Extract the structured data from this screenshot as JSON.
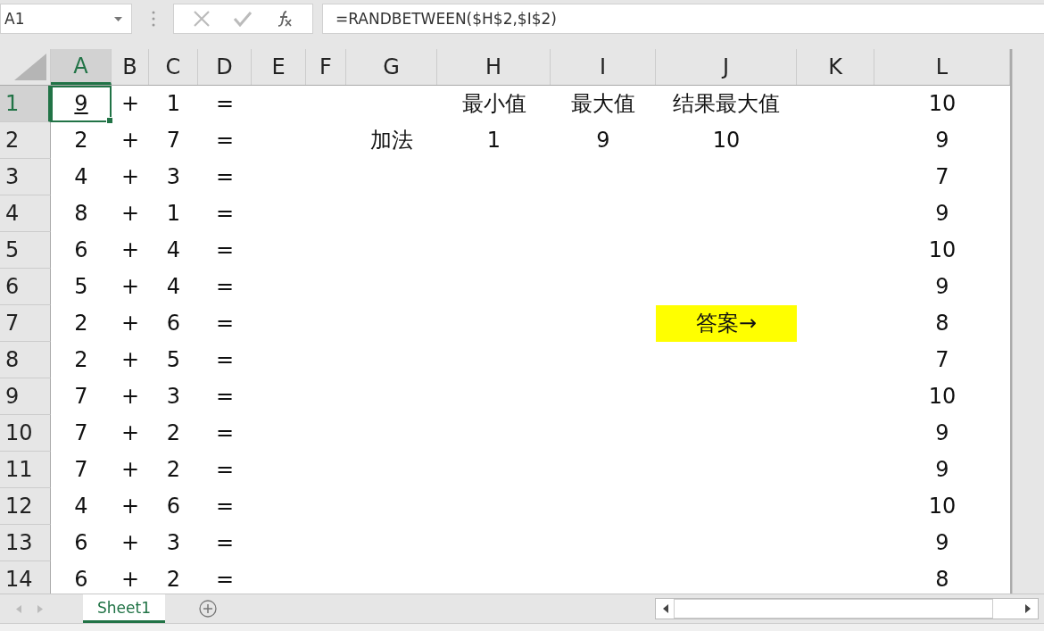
{
  "name_box": {
    "value": "A1"
  },
  "formula_bar": {
    "value": "=RANDBETWEEN($H$2,$I$2)"
  },
  "columns": [
    {
      "label": "A",
      "selected": true
    },
    {
      "label": "B",
      "selected": false
    },
    {
      "label": "C",
      "selected": false
    },
    {
      "label": "D",
      "selected": false
    },
    {
      "label": "E",
      "selected": false
    },
    {
      "label": "F",
      "selected": false
    },
    {
      "label": "G",
      "selected": false
    },
    {
      "label": "H",
      "selected": false
    },
    {
      "label": "I",
      "selected": false
    },
    {
      "label": "J",
      "selected": false
    },
    {
      "label": "K",
      "selected": false
    },
    {
      "label": "L",
      "selected": false
    }
  ],
  "rows": [
    {
      "label": "1",
      "selected": true,
      "cells": {
        "A": {
          "text": "9",
          "underline": true
        },
        "B": "+",
        "C": "1",
        "D": "=",
        "H": "最小值",
        "I": "最大值",
        "J": "结果最大值",
        "L": "10"
      }
    },
    {
      "label": "2",
      "selected": false,
      "cells": {
        "A": "2",
        "B": "+",
        "C": "7",
        "D": "=",
        "G": "加法",
        "H": "1",
        "I": "9",
        "J": "10",
        "L": "9"
      }
    },
    {
      "label": "3",
      "selected": false,
      "cells": {
        "A": "4",
        "B": "+",
        "C": "3",
        "D": "=",
        "L": "7"
      }
    },
    {
      "label": "4",
      "selected": false,
      "cells": {
        "A": "8",
        "B": "+",
        "C": "1",
        "D": "=",
        "L": "9"
      }
    },
    {
      "label": "5",
      "selected": false,
      "cells": {
        "A": "6",
        "B": "+",
        "C": "4",
        "D": "=",
        "L": "10"
      }
    },
    {
      "label": "6",
      "selected": false,
      "cells": {
        "A": "5",
        "B": "+",
        "C": "4",
        "D": "=",
        "L": "9"
      }
    },
    {
      "label": "7",
      "selected": false,
      "cells": {
        "A": "2",
        "B": "+",
        "C": "6",
        "D": "=",
        "J": {
          "text": "答案→",
          "color": "#ffff00"
        },
        "L": "8"
      }
    },
    {
      "label": "8",
      "selected": false,
      "cells": {
        "A": "2",
        "B": "+",
        "C": "5",
        "D": "=",
        "L": "7"
      }
    },
    {
      "label": "9",
      "selected": false,
      "cells": {
        "A": "7",
        "B": "+",
        "C": "3",
        "D": "=",
        "L": "10"
      }
    },
    {
      "label": "10",
      "selected": false,
      "cells": {
        "A": "7",
        "B": "+",
        "C": "2",
        "D": "=",
        "L": "9"
      }
    },
    {
      "label": "11",
      "selected": false,
      "cells": {
        "A": "7",
        "B": "+",
        "C": "2",
        "D": "=",
        "L": "9"
      }
    },
    {
      "label": "12",
      "selected": false,
      "cells": {
        "A": "4",
        "B": "+",
        "C": "6",
        "D": "=",
        "L": "10"
      }
    },
    {
      "label": "13",
      "selected": false,
      "cells": {
        "A": "6",
        "B": "+",
        "C": "3",
        "D": "=",
        "L": "9"
      }
    },
    {
      "label": "14",
      "selected": false,
      "cells": {
        "A": "6",
        "B": "+",
        "C": "2",
        "D": "=",
        "L": "8"
      }
    }
  ],
  "sheet_tabs": [
    {
      "label": "Sheet1",
      "selected": true
    }
  ]
}
